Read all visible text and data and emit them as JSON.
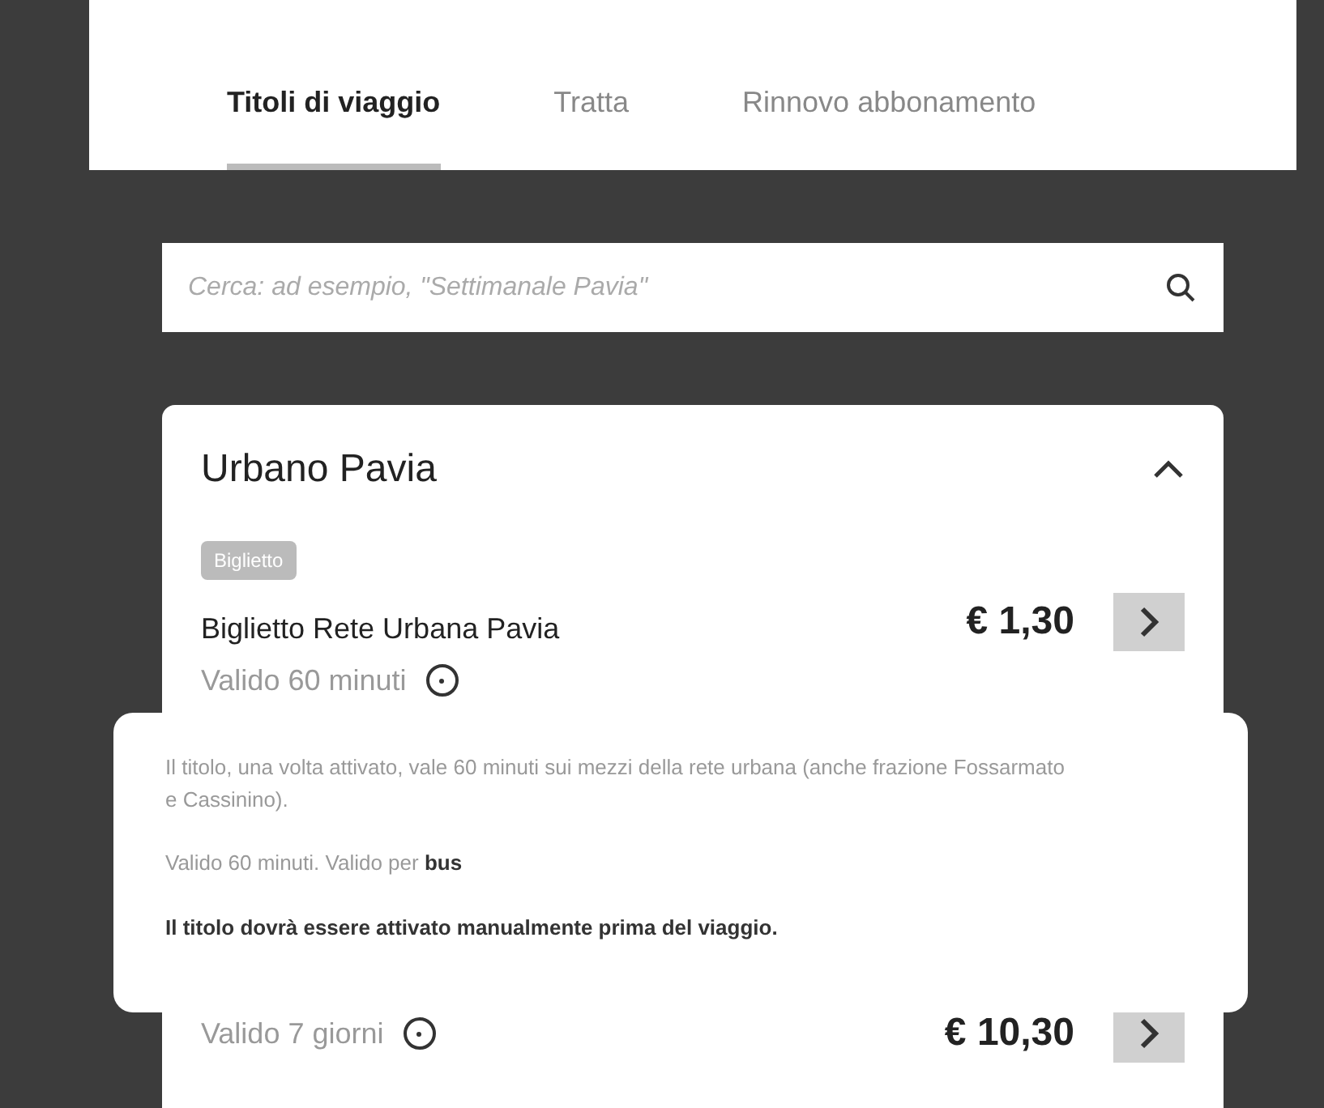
{
  "tabs": [
    {
      "label": "Titoli di viaggio",
      "selected": true
    },
    {
      "label": "Tratta",
      "selected": false
    },
    {
      "label": "Rinnovo abbonamento",
      "selected": false
    }
  ],
  "search": {
    "placeholder": "Cerca: ad esempio, \"Settimanale Pavia\""
  },
  "section": {
    "title": "Urbano Pavia",
    "expanded": true,
    "tickets": [
      {
        "tag": "Biglietto",
        "name": "Biglietto Rete Urbana Pavia",
        "validity": "Valido 60 minuti",
        "price": "€ 1,30"
      },
      {
        "validity": "Valido 7 giorni",
        "price": "€ 10,30"
      }
    ]
  },
  "tooltip": {
    "paragraphs": [
      "Il titolo, una volta attivato, vale 60 minuti sui mezzi della rete urbana (anche frazione Fossarmato e Cassinino).",
      "Valido 60 minuti. Valido per **bus**",
      "**Il titolo dovrà essere attivato manualmente prima del viaggio.**"
    ]
  }
}
